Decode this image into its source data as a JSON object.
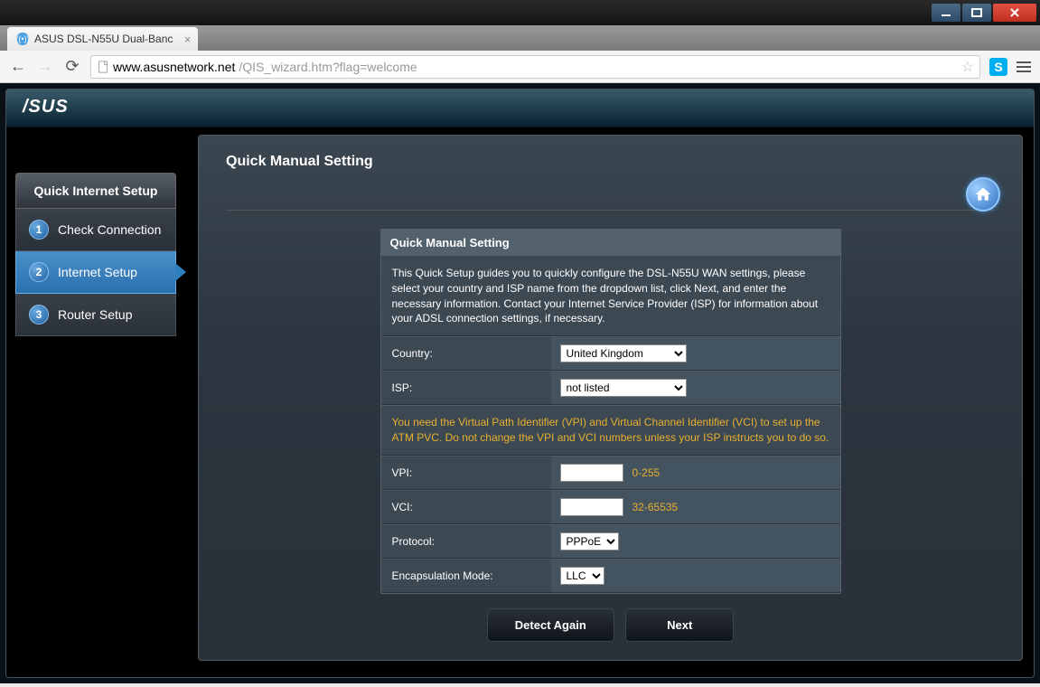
{
  "window": {
    "tab_title": "ASUS DSL-N55U Dual-Banc"
  },
  "address": {
    "domain": "www.asusnetwork.net",
    "path": "/QIS_wizard.htm?flag=welcome"
  },
  "logo": "/SUS",
  "sidebar": {
    "title": "Quick Internet Setup",
    "items": [
      {
        "num": "1",
        "label": "Check Connection"
      },
      {
        "num": "2",
        "label": "Internet Setup"
      },
      {
        "num": "3",
        "label": "Router Setup"
      }
    ]
  },
  "content": {
    "title": "Quick Manual Setting",
    "panel_header": "Quick Manual Setting",
    "description": "This Quick Setup guides you to quickly configure the DSL-N55U WAN settings, please select your country and ISP name from the dropdown list, click Next, and enter the necessary information. Contact your Internet Service Provider (ISP) for information about your ADSL connection settings, if necessary.",
    "note": "You need the Virtual Path Identifier (VPI) and Virtual Channel Identifier (VCI) to set up the ATM PVC. Do not change the VPI and VCI numbers unless your ISP instructs you to do so.",
    "fields": {
      "country_label": "Country:",
      "country_value": "United Kingdom",
      "isp_label": "ISP:",
      "isp_value": "not listed",
      "vpi_label": "VPI:",
      "vpi_value": "",
      "vpi_hint": "0-255",
      "vci_label": "VCI:",
      "vci_value": "",
      "vci_hint": "32-65535",
      "protocol_label": "Protocol:",
      "protocol_value": "PPPoE",
      "encap_label": "Encapsulation Mode:",
      "encap_value": "LLC"
    },
    "buttons": {
      "detect": "Detect Again",
      "next": "Next"
    }
  }
}
